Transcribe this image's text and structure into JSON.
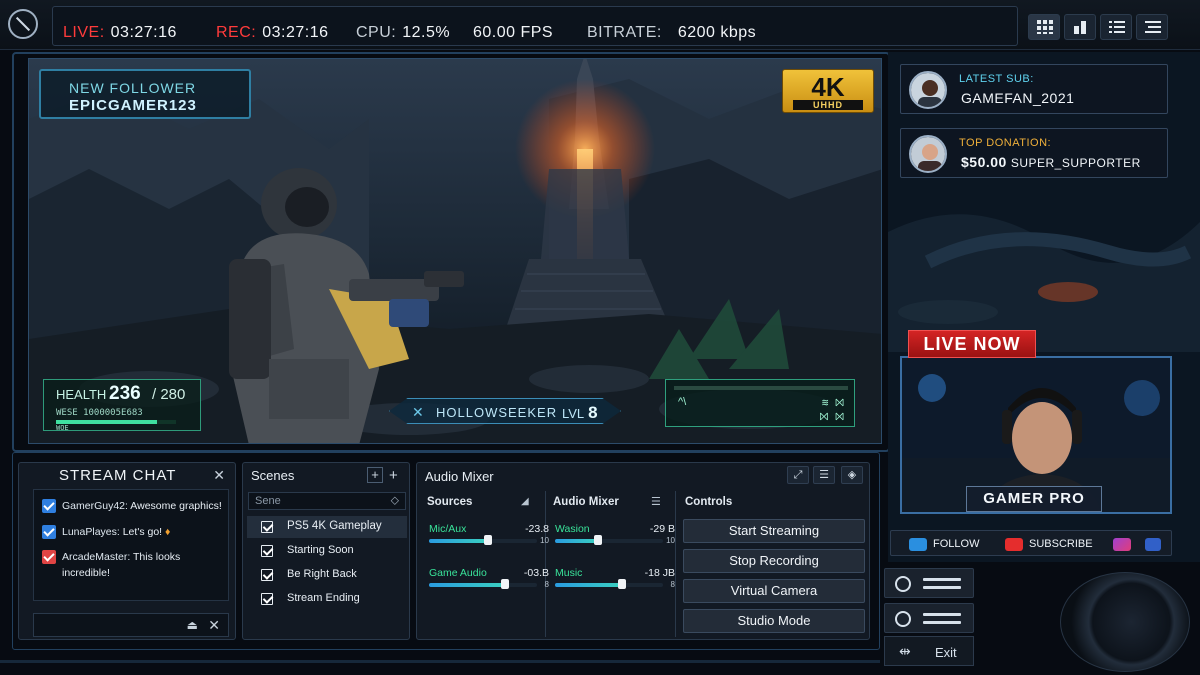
{
  "topbar": {
    "live_label": "LIVE:",
    "live_time": "03:27:16",
    "rec_label": "REC:",
    "rec_time": "03:27:16",
    "cpu_label": "CPU:",
    "cpu_value": "12.5%",
    "fps": "60.00 FPS",
    "bitrate_label": "BITRATE:",
    "bitrate_value": "6200 kbps"
  },
  "preview": {
    "follower_title": "NEW FOLLOWER",
    "follower_name": "EPICGAMER123",
    "badge_big": "4K",
    "badge_small": "UHHD",
    "health_label": "HEALTH",
    "health_value": "236",
    "health_max": "/ 280",
    "health_fraction": 0.843,
    "health_sub1": "WESE 1000005E683",
    "health_sub2": "WOE",
    "player_name": "HOLLOWSEEKER",
    "level_label": "LVL",
    "level_value": "8",
    "hud_t1": "^\\",
    "hud_t2": "≋ ⨝",
    "hud_t3": "⨝ ⨝"
  },
  "alerts": {
    "sub_title": "LATEST SUB:",
    "sub_name": "GAMEFAN_2021",
    "donation_title": "TOP DONATION:",
    "donation_amount": "$50.00",
    "donation_name": "SUPER_SUPPORTER"
  },
  "webcam": {
    "live_label": "LIVE NOW",
    "name": "GAMER PRO"
  },
  "social": {
    "follow": "FOLLOW",
    "subscribe": "SUBSCRIBE"
  },
  "side": {
    "exit_label": "Exit"
  },
  "chat": {
    "title": "STREAM CHAT",
    "messages": [
      {
        "user": "GamerGuy42:",
        "text": "Awesome graphics!"
      },
      {
        "user": "LunaPlayes:",
        "text": "Let's go!"
      },
      {
        "user": "ArcadeMaster:",
        "text": "This looks incredible!"
      }
    ]
  },
  "scenes": {
    "title": "Scenes",
    "search_placeholder": "Sene",
    "items": [
      {
        "label": "PS5 4K Gameplay"
      },
      {
        "label": "Starting Soon"
      },
      {
        "label": "Be Right Back"
      },
      {
        "label": "Stream Ending"
      }
    ]
  },
  "mixer": {
    "title": "Audio Mixer",
    "sources_header": "Sources",
    "mixer_header": "Audio Mixer",
    "controls_header": "Controls",
    "channels": [
      {
        "name": "Mic/Aux",
        "db": "-23.8",
        "level": 0.55,
        "right": "10"
      },
      {
        "name": "Wasion",
        "db": "-29 B",
        "level": 0.4,
        "right": "10"
      },
      {
        "name": "Game Audio",
        "db": "-03.B",
        "level": 0.7,
        "right": "8"
      },
      {
        "name": "Music",
        "db": "-18 JB",
        "level": 0.62,
        "right": "8"
      }
    ],
    "controls": [
      {
        "label": "Start Streaming"
      },
      {
        "label": "Stop Recording"
      },
      {
        "label": "Virtual Camera"
      },
      {
        "label": "Studio Mode"
      }
    ]
  },
  "colors": {
    "live_red": "#ff3b3b",
    "accent_cyan": "#5fd2ee",
    "meter_green": "#39e39a",
    "badge_gold": "#f0c23a"
  }
}
